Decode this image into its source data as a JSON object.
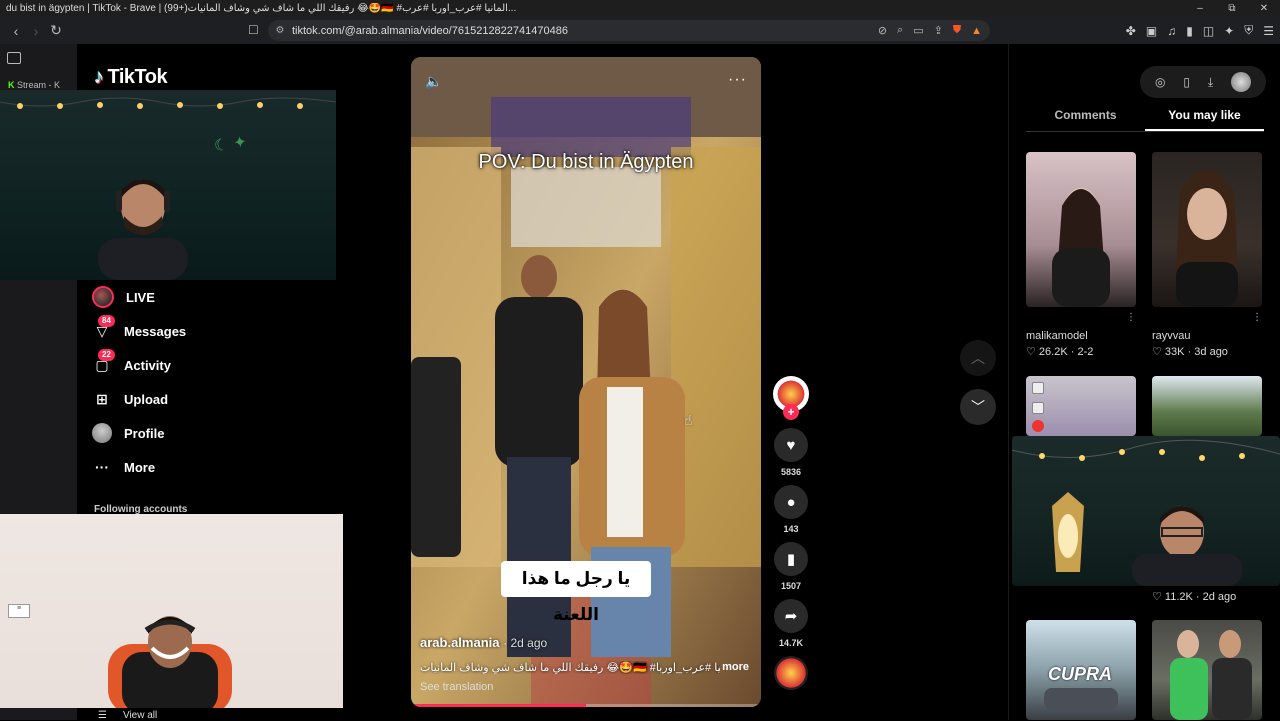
{
  "window": {
    "title": "du bist in ägypten | TikTok - Brave | (99+)رفيقك اللي ما شاف شي وشاف المانيات 😂🤩🇩🇪 #المانيا #عرب_اوربا #عرب...",
    "controls": [
      "–",
      "⧉",
      "✕"
    ]
  },
  "browser": {
    "url": "tiktok.com/@arab.almania/video/7615212822741470486",
    "lock_icon": "site-info-icon"
  },
  "leftstrip": {
    "stream_label": "Stream - K"
  },
  "sidebar": {
    "logo_text": "TikTok",
    "items": [
      {
        "label": "LIVE",
        "icon": "live-avatar-icon",
        "badge": ""
      },
      {
        "label": "Messages",
        "icon": "messages-icon",
        "badge": "84"
      },
      {
        "label": "Activity",
        "icon": "activity-icon",
        "badge": "22"
      },
      {
        "label": "Upload",
        "icon": "upload-icon",
        "badge": ""
      },
      {
        "label": "Profile",
        "icon": "profile-avatar-icon",
        "badge": ""
      },
      {
        "label": "More",
        "icon": "more-icon",
        "badge": ""
      }
    ],
    "following_title": "Following accounts",
    "view_all": "View all"
  },
  "video": {
    "overlay_text": "POV: Du bist in Ägypten",
    "caption": "يا رجل ما هذا اللعنة",
    "author": "arab.almania",
    "date": "2d ago",
    "description": "رفيقك اللي ما شاف شي وشاف المانيات 😂🤩🇩🇪 #المانيا #عرب_اوربا ...",
    "more": "more",
    "see_translation": "See translation",
    "progress": 0.5
  },
  "actions": {
    "likes": "5836",
    "comments": "143",
    "saves": "1507",
    "shares": "14.7K"
  },
  "rpanel": {
    "tabs": [
      {
        "label": "Comments",
        "active": false
      },
      {
        "label": "You may like",
        "active": true
      }
    ],
    "cards": [
      {
        "name": "malikamodel",
        "likes": "26.2K",
        "date": "2-2"
      },
      {
        "name": "rayvvau",
        "likes": "33K",
        "date": "3d ago"
      },
      {
        "name": "",
        "likes": "11.2K",
        "date": "2d ago"
      }
    ],
    "cupra_label": "CUPRA"
  },
  "colors": {
    "accent": "#fe2c55",
    "background": "#000000"
  }
}
